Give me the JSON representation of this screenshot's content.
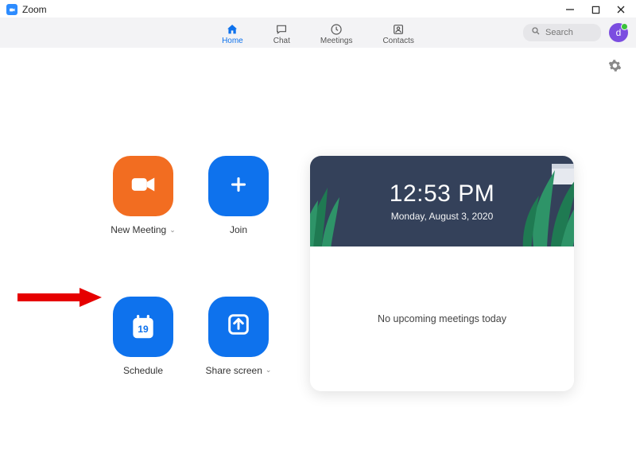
{
  "window": {
    "title": "Zoom"
  },
  "nav": {
    "home": "Home",
    "chat": "Chat",
    "meetings": "Meetings",
    "contacts": "Contacts"
  },
  "search": {
    "placeholder": "Search"
  },
  "avatar": {
    "initial": "d"
  },
  "actions": {
    "new_meeting": "New Meeting",
    "join": "Join",
    "schedule": "Schedule",
    "schedule_day": "19",
    "share_screen": "Share screen"
  },
  "clock": {
    "time": "12:53 PM",
    "date": "Monday, August 3, 2020"
  },
  "meetings": {
    "empty": "No upcoming meetings today"
  }
}
